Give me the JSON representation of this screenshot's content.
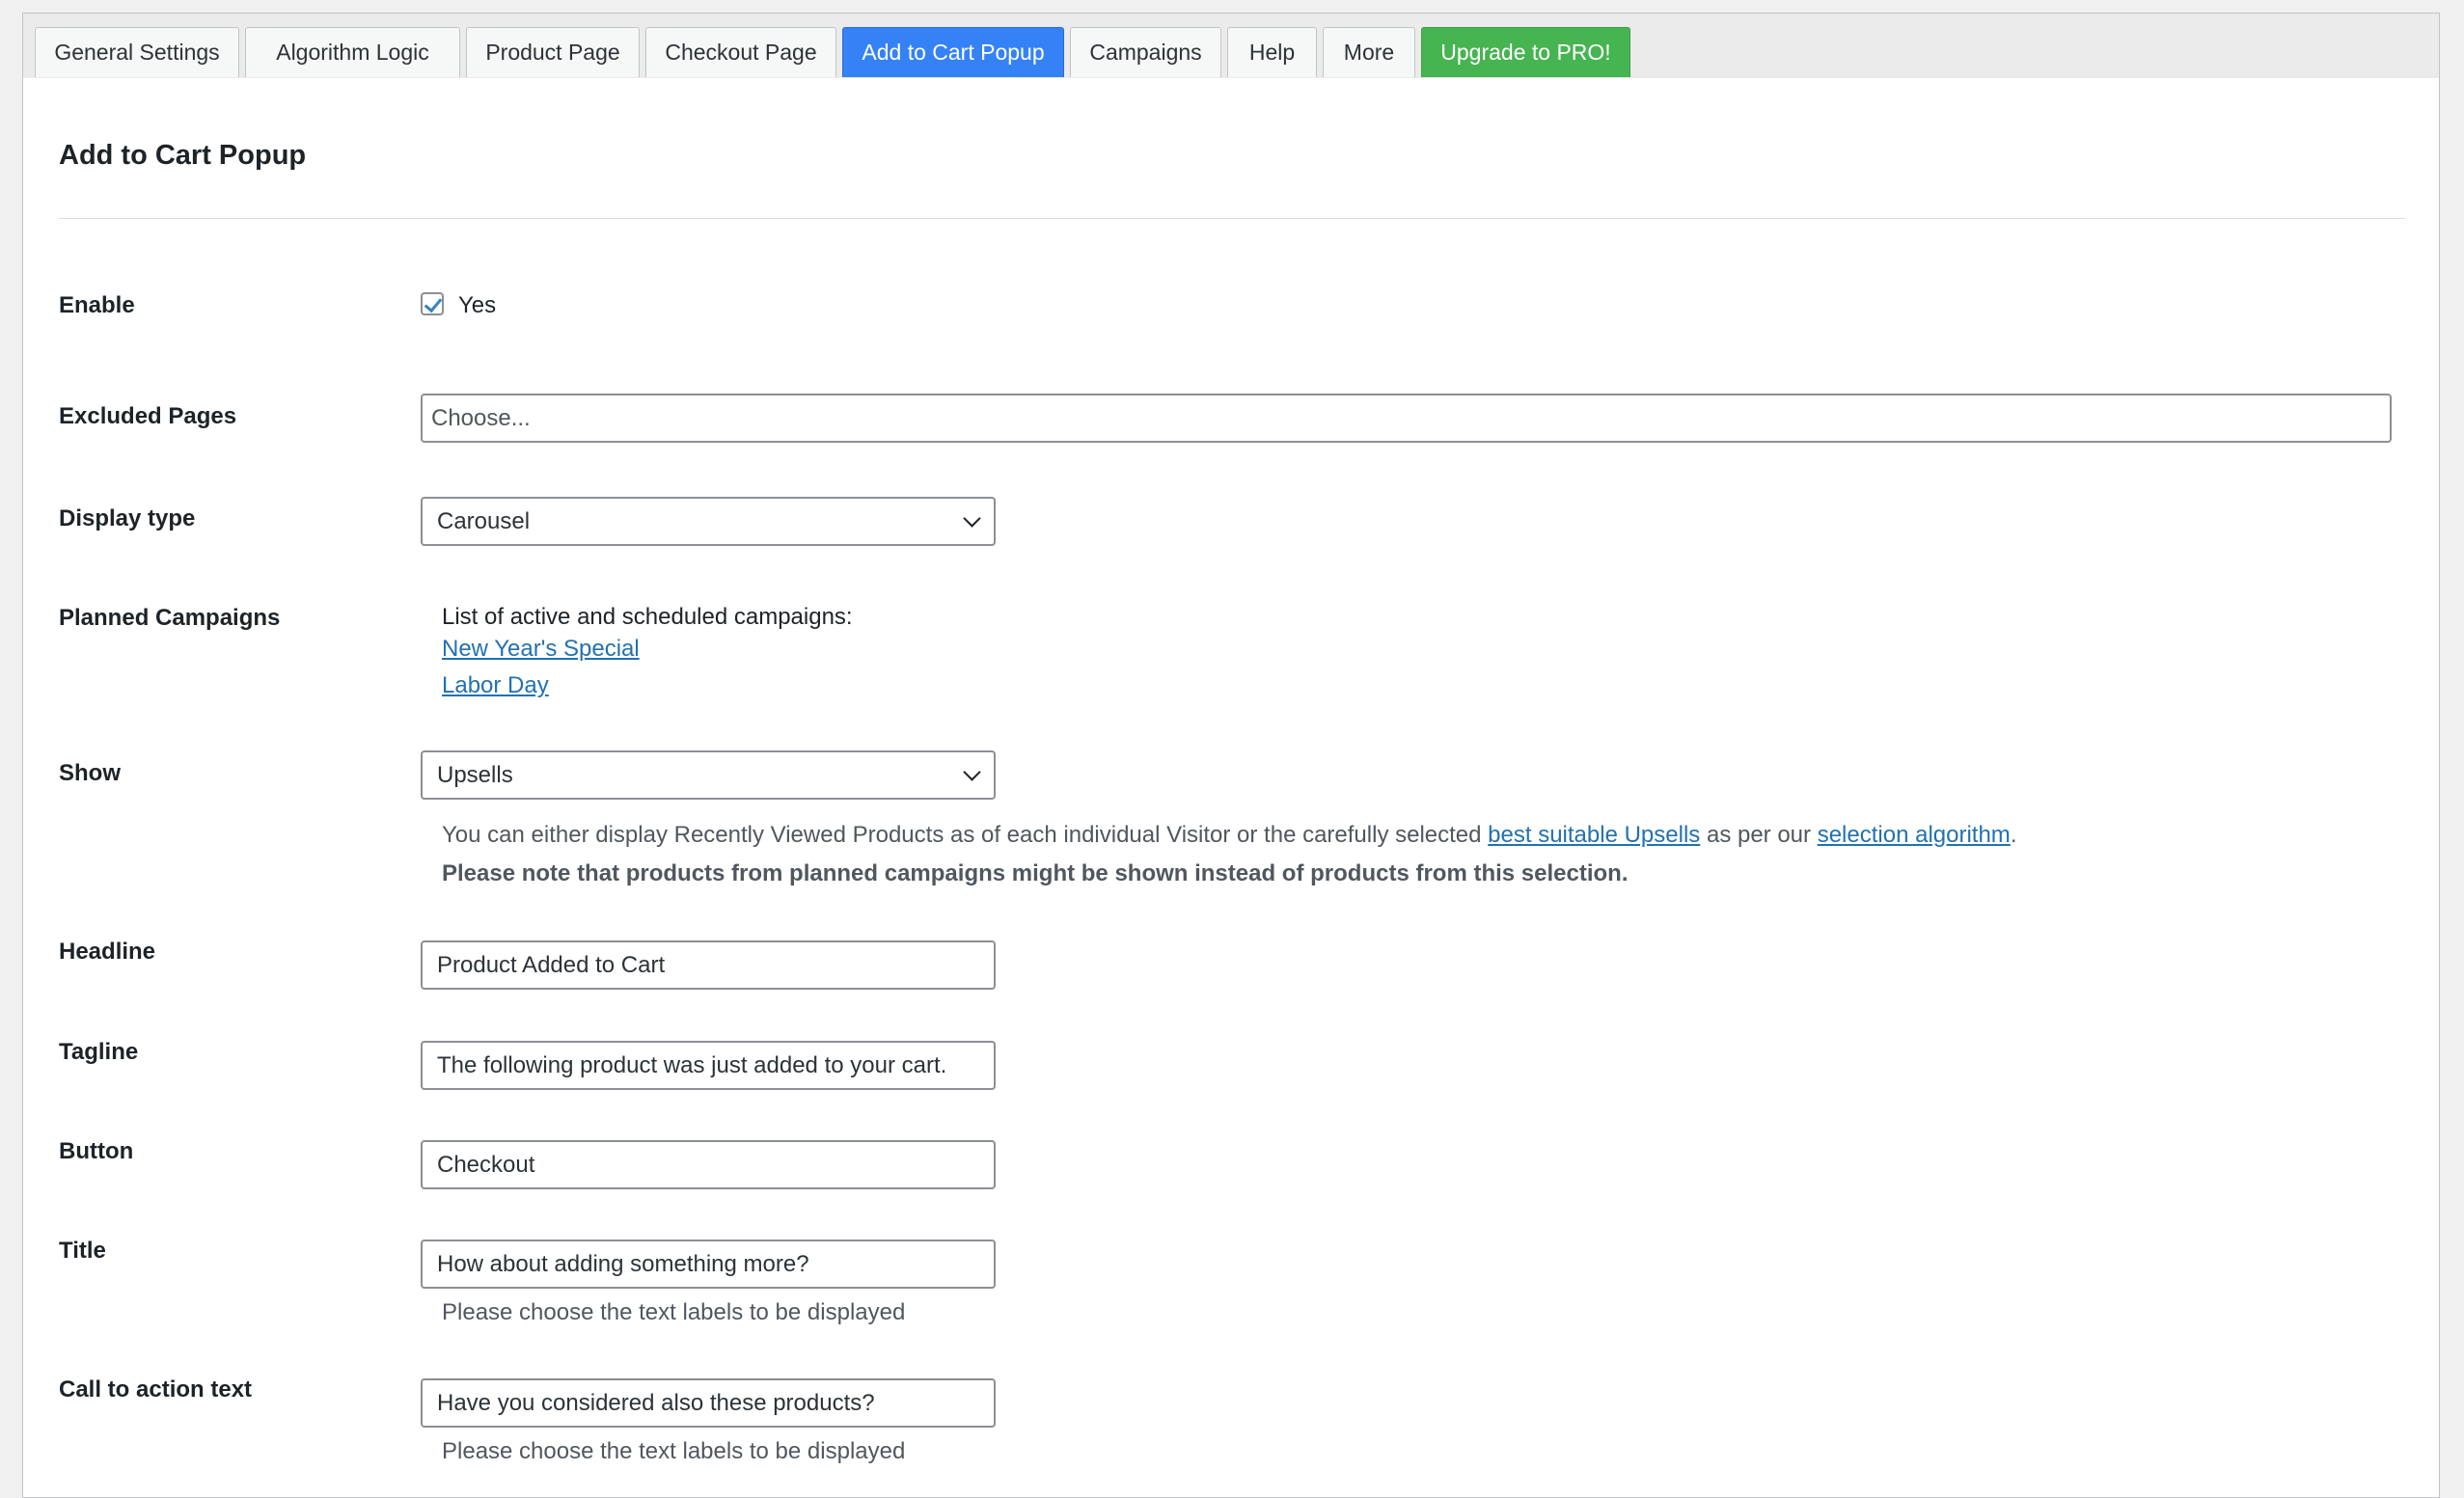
{
  "tabs": [
    {
      "label": "General Settings"
    },
    {
      "label": "Algorithm Logic"
    },
    {
      "label": "Product Page"
    },
    {
      "label": "Checkout Page"
    },
    {
      "label": "Add to Cart Popup"
    },
    {
      "label": "Campaigns"
    },
    {
      "label": "Help"
    },
    {
      "label": "More"
    },
    {
      "label": "Upgrade to PRO!"
    }
  ],
  "page_title": "Add to Cart Popup",
  "enable": {
    "label": "Enable",
    "checkbox_label": "Yes",
    "checked": true
  },
  "excluded_pages": {
    "label": "Excluded Pages",
    "placeholder": "Choose..."
  },
  "display_type": {
    "label": "Display type",
    "value": "Carousel"
  },
  "planned_campaigns": {
    "label": "Planned Campaigns",
    "intro": "List of active and scheduled campaigns:",
    "items": [
      "New Year's Special",
      "Labor Day"
    ]
  },
  "show": {
    "label": "Show",
    "value": "Upsells",
    "desc_prefix": "You can either display Recently Viewed Products as of each individual Visitor or the carefully selected ",
    "desc_link1": "best suitable Upsells",
    "desc_middle": " as per our ",
    "desc_link2": "selection algorithm",
    "desc_suffix": ".",
    "note": "Please note that products from planned campaigns might be shown instead of products from this selection."
  },
  "headline": {
    "label": "Headline",
    "value": "Product Added to Cart"
  },
  "tagline": {
    "label": "Tagline",
    "value": "The following product was just added to your cart."
  },
  "button": {
    "label": "Button",
    "value": "Checkout"
  },
  "title": {
    "label": "Title",
    "value": "How about adding something more?",
    "help": "Please choose the text labels to be displayed"
  },
  "cta": {
    "label": "Call to action text",
    "value": "Have you considered also these products?",
    "help": "Please choose the text labels to be displayed"
  },
  "colors": {
    "active_tab": "#3582f7",
    "pro_tab": "#46b450",
    "link": "#2271b1"
  }
}
